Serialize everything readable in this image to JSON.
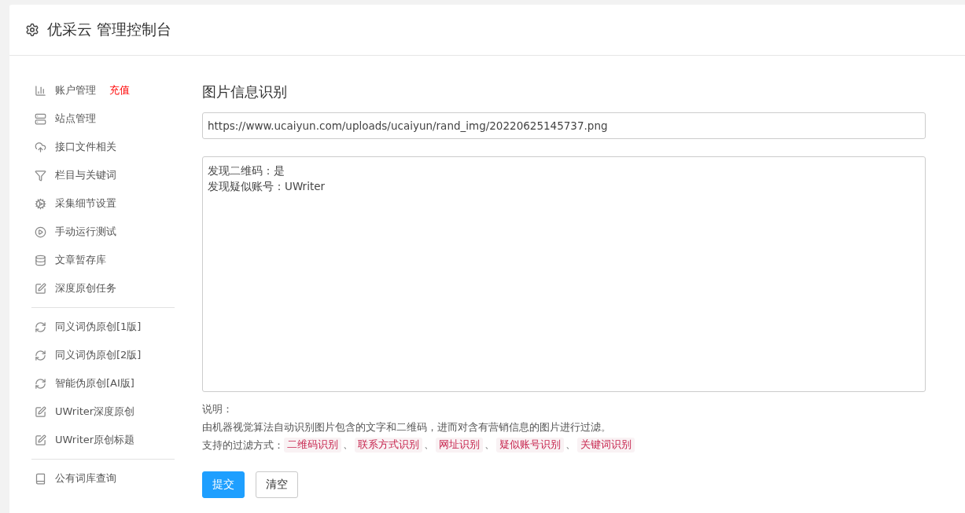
{
  "header": {
    "title": "优采云 管理控制台"
  },
  "sidebar": {
    "groups": [
      {
        "items": [
          {
            "label": "账户管理",
            "badge": "充值"
          },
          {
            "label": "站点管理"
          },
          {
            "label": "接口文件相关"
          },
          {
            "label": "栏目与关键词"
          },
          {
            "label": "采集细节设置"
          },
          {
            "label": "手动运行测试"
          },
          {
            "label": "文章暂存库"
          },
          {
            "label": "深度原创任务"
          }
        ]
      },
      {
        "items": [
          {
            "label": "同义词伪原创[1版]"
          },
          {
            "label": "同义词伪原创[2版]"
          },
          {
            "label": "智能伪原创[AI版]"
          },
          {
            "label": "UWriter深度原创"
          },
          {
            "label": "UWriter原创标题"
          }
        ]
      },
      {
        "items": [
          {
            "label": "公有词库查询"
          }
        ]
      }
    ]
  },
  "main": {
    "title": "图片信息识别",
    "url_field": {
      "value": "https://www.ucaiyun.com/uploads/ucaiyun/rand_img/20220625145737.png"
    },
    "result_field": {
      "lines": [
        "发现二维码：是",
        "发现疑似账号：UWriter"
      ]
    },
    "note_label": "说明：",
    "note_text": "由机器视觉算法自动识别图片包含的文字和二维码，进而对含有营销信息的图片进行过滤。",
    "filters_label": "支持的过滤方式：",
    "filters_separator": "、",
    "filters": [
      "二维码识别",
      "联系方式识别",
      "网址识别",
      "疑似账号识别",
      "关键词识别"
    ],
    "buttons": [
      {
        "label": "提交",
        "kind": "primary"
      },
      {
        "label": "清空",
        "kind": "default"
      }
    ]
  }
}
